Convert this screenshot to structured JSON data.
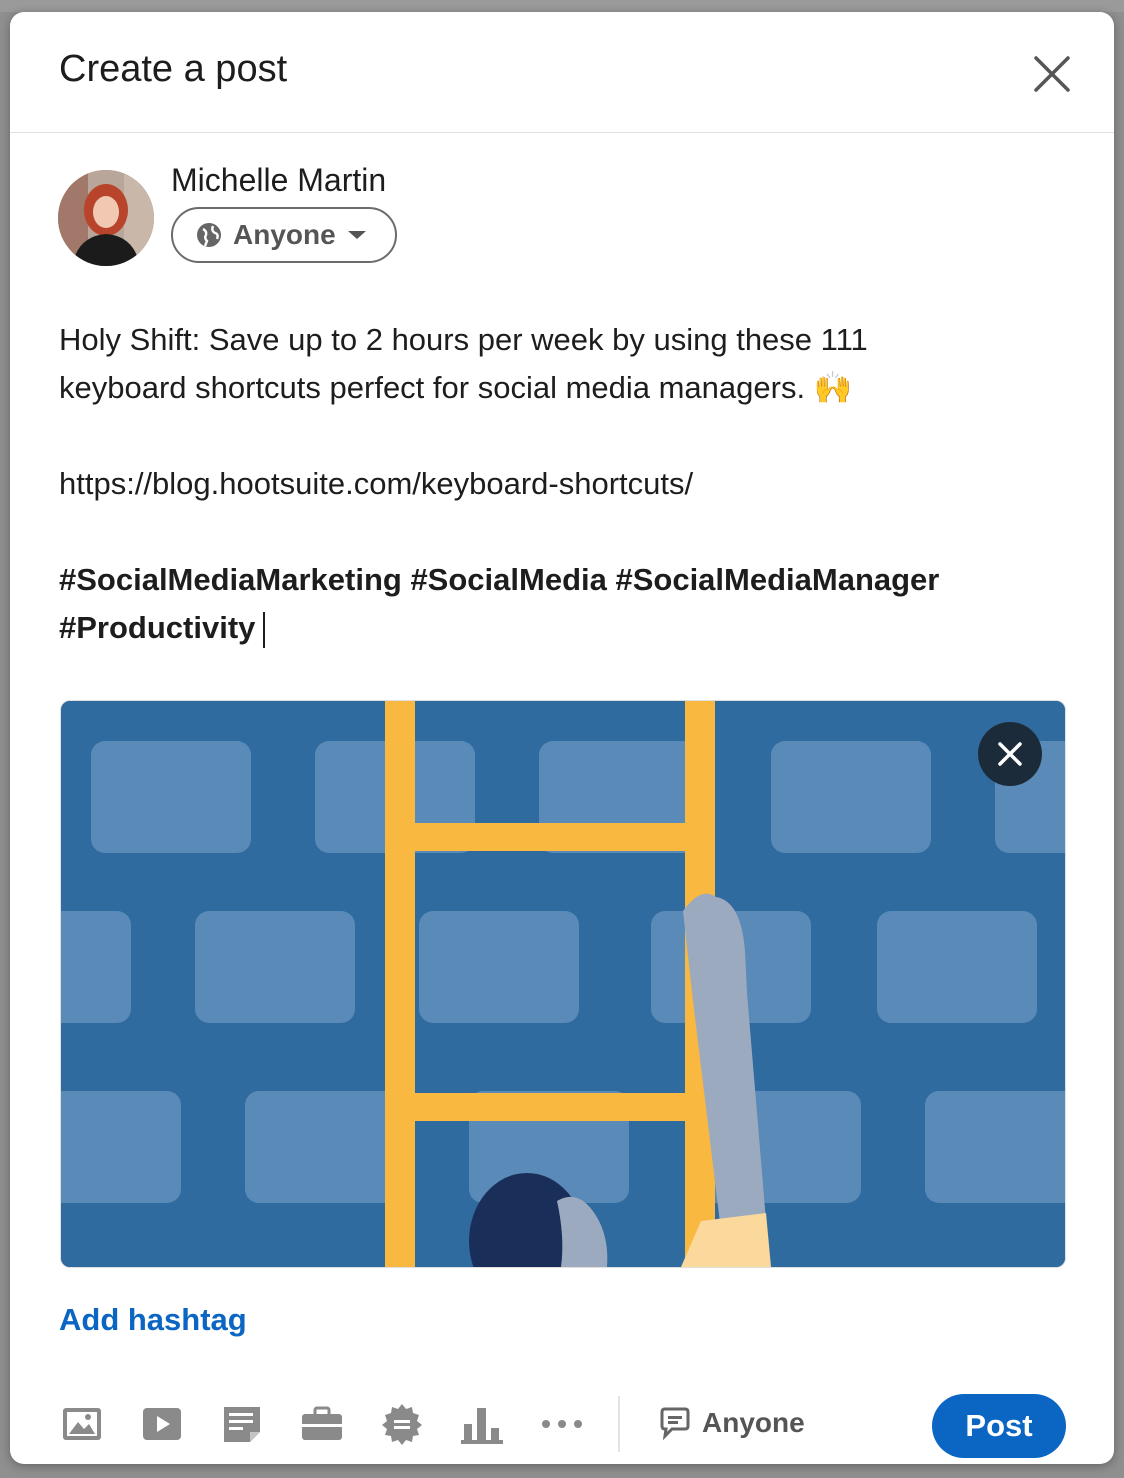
{
  "modal": {
    "title": "Create a post"
  },
  "author": {
    "name": "Michelle Martin",
    "visibility": "Anyone"
  },
  "post": {
    "line1": "Holy Shift: Save up to 2 hours per week by using these 111",
    "line2": "keyboard shortcuts perfect for social media managers. 🙌",
    "link": "https://blog.hootsuite.com/keyboard-shortcuts/",
    "hashtags_line1": "#SocialMediaMarketing #SocialMedia #SocialMediaManager",
    "hashtags_line2": "#Productivity"
  },
  "add_hashtag_label": "Add hashtag",
  "toolbar": {
    "icons": [
      "photo-icon",
      "video-icon",
      "document-icon",
      "job-icon",
      "celebrate-icon",
      "poll-icon",
      "more-icon"
    ],
    "comment_visibility": "Anyone",
    "post_label": "Post"
  },
  "colors": {
    "accent": "#0a66c2",
    "media_bg": "#2f6b9e",
    "ladder": "#f9b83f"
  }
}
